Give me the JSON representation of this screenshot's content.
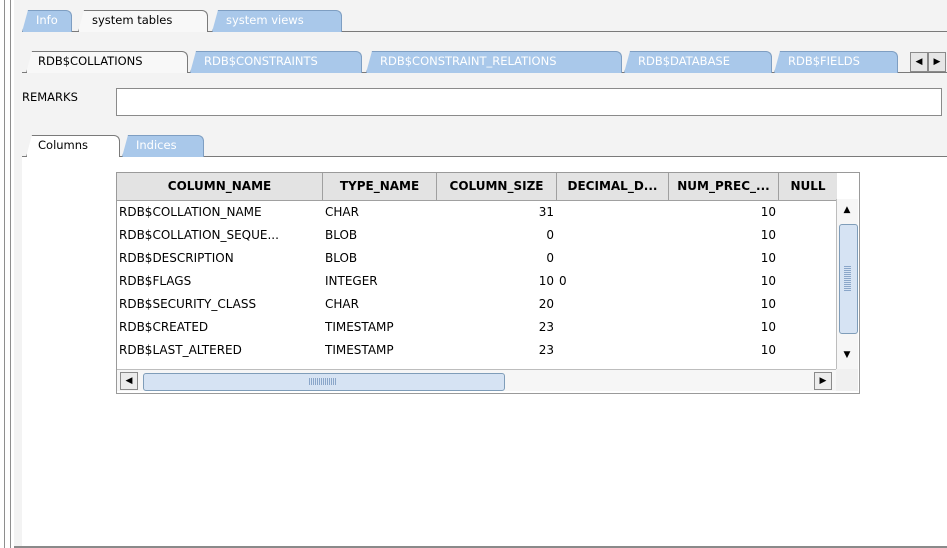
{
  "top_tabs": [
    {
      "label": "Info",
      "state": "inactive"
    },
    {
      "label": "system tables",
      "state": "active"
    },
    {
      "label": "system views",
      "state": "inactive"
    }
  ],
  "table_tabs": [
    {
      "label": "RDB$COLLATIONS",
      "state": "active"
    },
    {
      "label": "RDB$CONSTRAINTS",
      "state": "inactive"
    },
    {
      "label": "RDB$CONSTRAINT_RELATIONS",
      "state": "inactive"
    },
    {
      "label": "RDB$DATABASE",
      "state": "inactive"
    },
    {
      "label": "RDB$FIELDS",
      "state": "inactive"
    }
  ],
  "remarks": {
    "label": "REMARKS",
    "value": ""
  },
  "detail_tabs": [
    {
      "label": "Columns",
      "state": "active"
    },
    {
      "label": "Indices",
      "state": "inactive"
    }
  ],
  "grid": {
    "columns": [
      "COLUMN_NAME",
      "TYPE_NAME",
      "COLUMN_SIZE",
      "DECIMAL_D...",
      "NUM_PREC_...",
      "NULL"
    ],
    "rows": [
      [
        "RDB$COLLATION_NAME",
        "CHAR",
        "31",
        "",
        "10"
      ],
      [
        "RDB$COLLATION_SEQUE...",
        "BLOB",
        "0",
        "",
        "10"
      ],
      [
        "RDB$DESCRIPTION",
        "BLOB",
        "0",
        "",
        "10"
      ],
      [
        "RDB$FLAGS",
        "INTEGER",
        "10",
        "0",
        "10"
      ],
      [
        "RDB$SECURITY_CLASS",
        "CHAR",
        "20",
        "",
        "10"
      ],
      [
        "RDB$CREATED",
        "TIMESTAMP",
        "23",
        "",
        "10"
      ],
      [
        "RDB$LAST_ALTERED",
        "TIMESTAMP",
        "23",
        "",
        "10"
      ]
    ]
  },
  "icons": {
    "scroll_up": "▲",
    "scroll_down": "▼",
    "scroll_left": "◀",
    "scroll_right": "▶"
  },
  "colors": {
    "inactive_tab": "#a9c8ea",
    "scroll_thumb": "#d6e3f3"
  }
}
